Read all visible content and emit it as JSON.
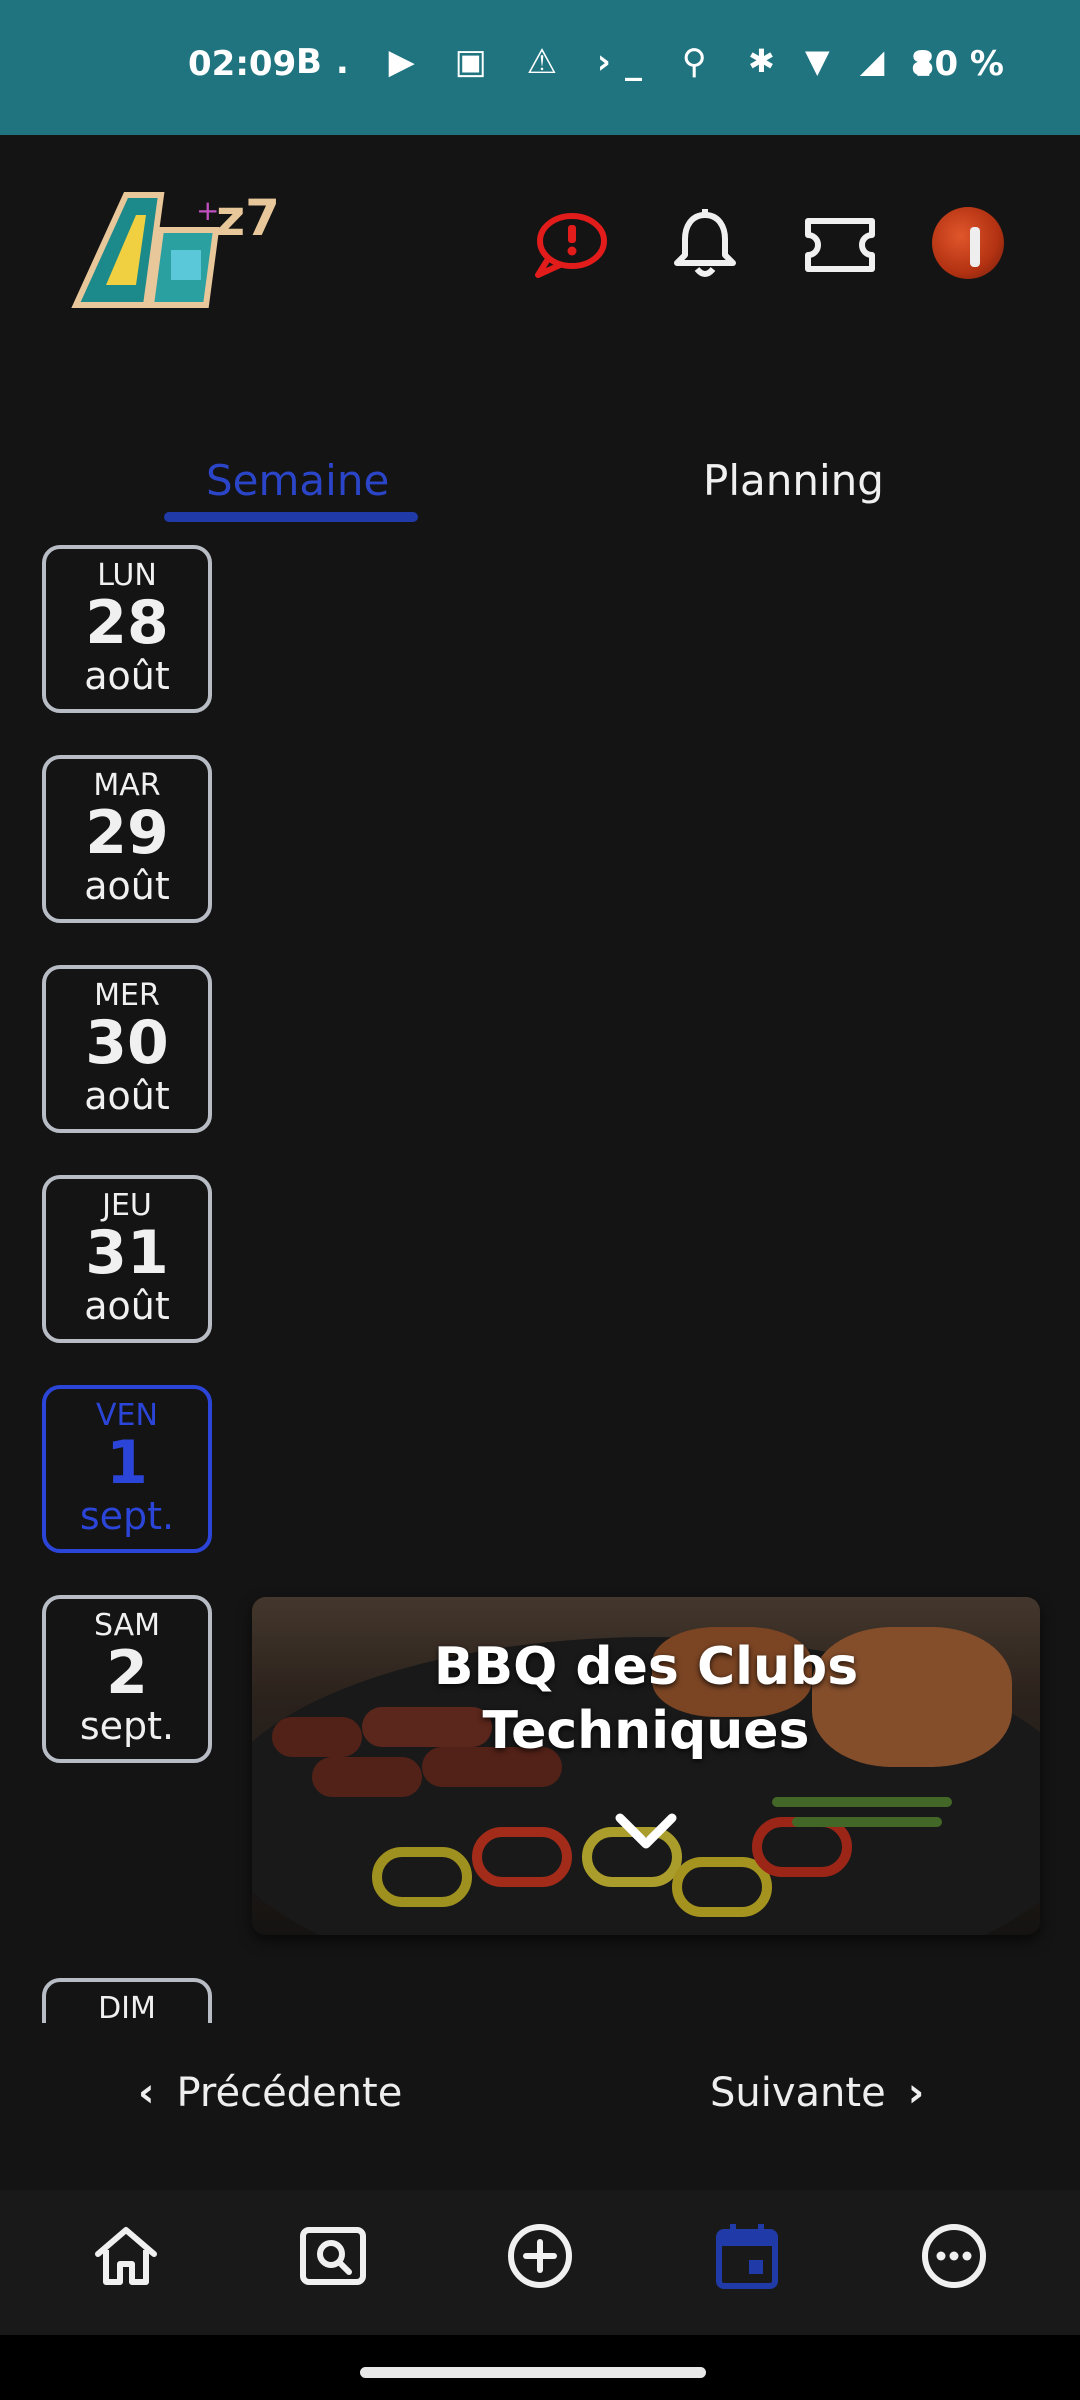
{
  "status_bar": {
    "time": "02:09",
    "battery": "80 %",
    "left_icons": "B. ▶ ▣ ⚠ ›_ ⚲",
    "right_icons": "✱ ▼ ◢ ▮"
  },
  "header": {
    "logo_icon": "ae-logo",
    "alert_icon": "alert-bubble-icon",
    "bell_icon": "bell-icon",
    "ticket_icon": "ticket-icon",
    "avatar": "profile-avatar"
  },
  "tabs": [
    {
      "label": "Semaine",
      "selected": true
    },
    {
      "label": "Planning",
      "selected": false
    }
  ],
  "days": [
    {
      "name": "LUN",
      "date": "28",
      "month": "août"
    },
    {
      "name": "MAR",
      "date": "29",
      "month": "août"
    },
    {
      "name": "MER",
      "date": "30",
      "month": "août"
    },
    {
      "name": "JEU",
      "date": "31",
      "month": "août"
    },
    {
      "name": "VEN",
      "date": "1",
      "month": "sept.",
      "active": true
    },
    {
      "name": "SAM",
      "date": "2",
      "month": "sept."
    },
    {
      "name": "DIM",
      "date": "",
      "month": ""
    }
  ],
  "event": {
    "title_line1": "BBQ des Clubs",
    "title_line2": "Techniques",
    "expand_icon": "chevron-down-icon"
  },
  "pager": {
    "prev": "Précédente",
    "next": "Suivante"
  },
  "bottom_nav": [
    "home-icon",
    "search-icon",
    "add-icon",
    "calendar-icon",
    "more-icon"
  ],
  "colors": {
    "accent": "#2b45c8",
    "status_bar": "#1f7480",
    "background": "#141414",
    "alert": "#e21b1b"
  }
}
